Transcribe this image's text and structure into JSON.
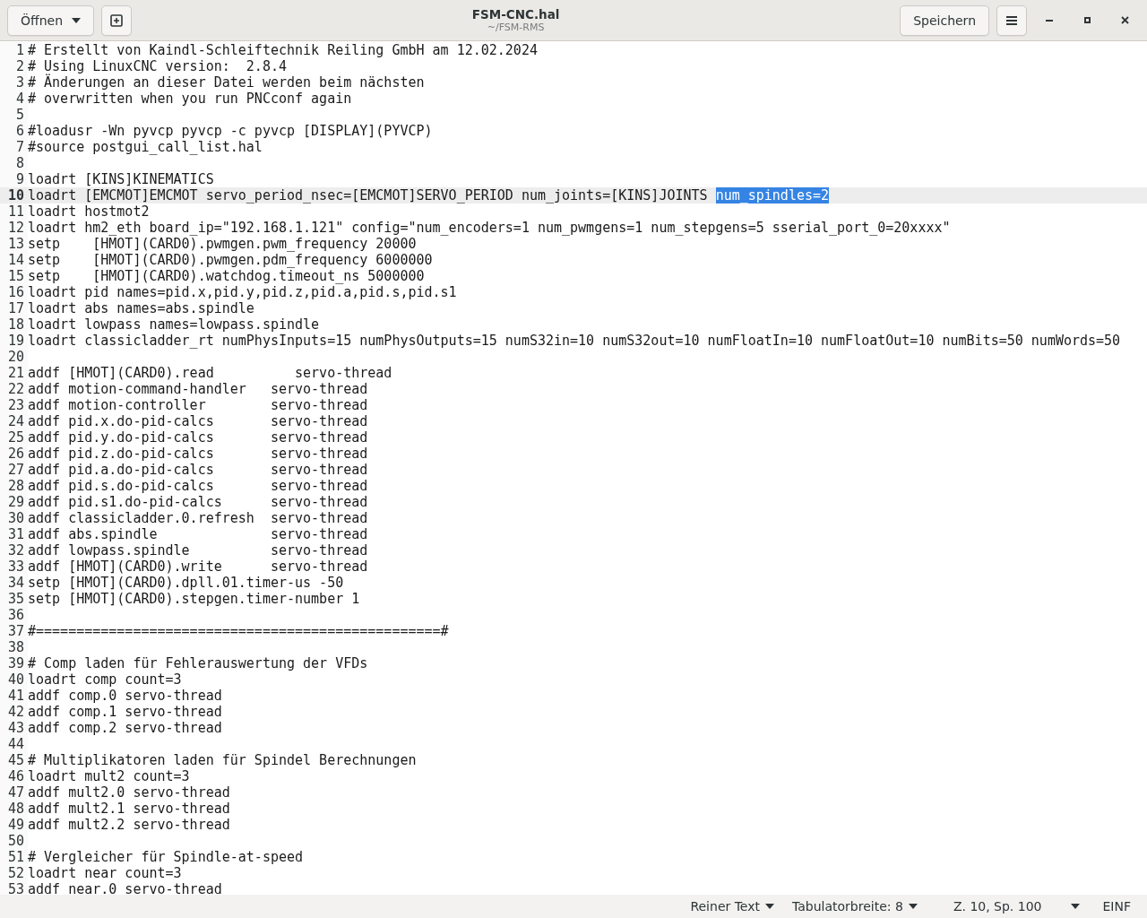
{
  "header": {
    "open_button": "Öffnen",
    "title": "FSM-CNC.hal",
    "subtitle": "~/FSM-RMS",
    "save_button": "Speichern"
  },
  "lines": [
    {
      "number": "1",
      "text": "# Erstellt von Kaindl-Schleiftechnik Reiling GmbH am 12.02.2024",
      "current": false
    },
    {
      "number": "2",
      "text": "# Using LinuxCNC version:  2.8.4",
      "current": false
    },
    {
      "number": "3",
      "text": "# Änderungen an dieser Datei werden beim nächsten",
      "current": false
    },
    {
      "number": "4",
      "text": "# overwritten when you run PNCconf again",
      "current": false
    },
    {
      "number": "5",
      "current": false
    },
    {
      "number": "6",
      "text": "#loadusr -Wn pyvcp pyvcp -c pyvcp [DISPLAY](PYVCP)",
      "current": false
    },
    {
      "number": "7",
      "text": "#source postgui_call_list.hal",
      "current": false
    },
    {
      "number": "8",
      "current": false
    },
    {
      "number": "9",
      "text": "loadrt [KINS]KINEMATICS",
      "current": false
    },
    {
      "number": "10",
      "text": "loadrt [EMCMOT]EMCMOT servo_period_nsec=[EMCMOT]SERVO_PERIOD num_joints=[KINS]JOINTS ",
      "selection": "num_spindles=2",
      "current": true
    },
    {
      "number": "11",
      "text": "loadrt hostmot2",
      "current": false
    },
    {
      "number": "12",
      "text": "loadrt hm2_eth board_ip=\"192.168.1.121\" config=\"num_encoders=1 num_pwmgens=1 num_stepgens=5 sserial_port_0=20xxxx\"",
      "current": false
    },
    {
      "number": "13",
      "text": "setp    [HMOT](CARD0).pwmgen.pwm_frequency 20000",
      "current": false
    },
    {
      "number": "14",
      "text": "setp    [HMOT](CARD0).pwmgen.pdm_frequency 6000000",
      "current": false
    },
    {
      "number": "15",
      "text": "setp    [HMOT](CARD0).watchdog.timeout_ns 5000000",
      "current": false
    },
    {
      "number": "16",
      "text": "loadrt pid names=pid.x,pid.y,pid.z,pid.a,pid.s,pid.s1",
      "current": false
    },
    {
      "number": "17",
      "text": "loadrt abs names=abs.spindle",
      "current": false
    },
    {
      "number": "18",
      "text": "loadrt lowpass names=lowpass.spindle",
      "current": false
    },
    {
      "number": "19",
      "text": "loadrt classicladder_rt numPhysInputs=15 numPhysOutputs=15 numS32in=10 numS32out=10 numFloatIn=10 numFloatOut=10 numBits=50 numWords=50",
      "current": false
    },
    {
      "number": "20",
      "current": false
    },
    {
      "number": "21",
      "text": "addf [HMOT](CARD0).read          servo-thread",
      "current": false
    },
    {
      "number": "22",
      "text": "addf motion-command-handler   servo-thread",
      "current": false
    },
    {
      "number": "23",
      "text": "addf motion-controller        servo-thread",
      "current": false
    },
    {
      "number": "24",
      "text": "addf pid.x.do-pid-calcs       servo-thread",
      "current": false
    },
    {
      "number": "25",
      "text": "addf pid.y.do-pid-calcs       servo-thread",
      "current": false
    },
    {
      "number": "26",
      "text": "addf pid.z.do-pid-calcs       servo-thread",
      "current": false
    },
    {
      "number": "27",
      "text": "addf pid.a.do-pid-calcs       servo-thread",
      "current": false
    },
    {
      "number": "28",
      "text": "addf pid.s.do-pid-calcs       servo-thread",
      "current": false
    },
    {
      "number": "29",
      "text": "addf pid.s1.do-pid-calcs      servo-thread",
      "current": false
    },
    {
      "number": "30",
      "text": "addf classicladder.0.refresh  servo-thread",
      "current": false
    },
    {
      "number": "31",
      "text": "addf abs.spindle              servo-thread",
      "current": false
    },
    {
      "number": "32",
      "text": "addf lowpass.spindle          servo-thread",
      "current": false
    },
    {
      "number": "33",
      "text": "addf [HMOT](CARD0).write      servo-thread",
      "current": false
    },
    {
      "number": "34",
      "text": "setp [HMOT](CARD0).dpll.01.timer-us -50",
      "current": false
    },
    {
      "number": "35",
      "text": "setp [HMOT](CARD0).stepgen.timer-number 1",
      "current": false
    },
    {
      "number": "36",
      "current": false
    },
    {
      "number": "37",
      "text": "#==================================================#",
      "current": false
    },
    {
      "number": "38",
      "current": false
    },
    {
      "number": "39",
      "text": "# Comp laden für Fehlerauswertung der VFDs",
      "current": false
    },
    {
      "number": "40",
      "text": "loadrt comp count=3",
      "current": false
    },
    {
      "number": "41",
      "text": "addf comp.0 servo-thread",
      "current": false
    },
    {
      "number": "42",
      "text": "addf comp.1 servo-thread",
      "current": false
    },
    {
      "number": "43",
      "text": "addf comp.2 servo-thread",
      "current": false
    },
    {
      "number": "44",
      "current": false
    },
    {
      "number": "45",
      "text": "# Multiplikatoren laden für Spindel Berechnungen",
      "current": false
    },
    {
      "number": "46",
      "text": "loadrt mult2 count=3",
      "current": false
    },
    {
      "number": "47",
      "text": "addf mult2.0 servo-thread",
      "current": false
    },
    {
      "number": "48",
      "text": "addf mult2.1 servo-thread",
      "current": false
    },
    {
      "number": "49",
      "text": "addf mult2.2 servo-thread",
      "current": false
    },
    {
      "number": "50",
      "current": false
    },
    {
      "number": "51",
      "text": "# Vergleicher für Spindle-at-speed",
      "current": false
    },
    {
      "number": "52",
      "text": "loadrt near count=3",
      "current": false
    },
    {
      "number": "53",
      "text": "addf near.0 servo-thread",
      "current": false
    }
  ],
  "status_bar": {
    "syntax": "Reiner Text",
    "tab_width": "Tabulatorbreite: 8",
    "position": "Z. 10, Sp. 100",
    "mode": "EINF"
  }
}
